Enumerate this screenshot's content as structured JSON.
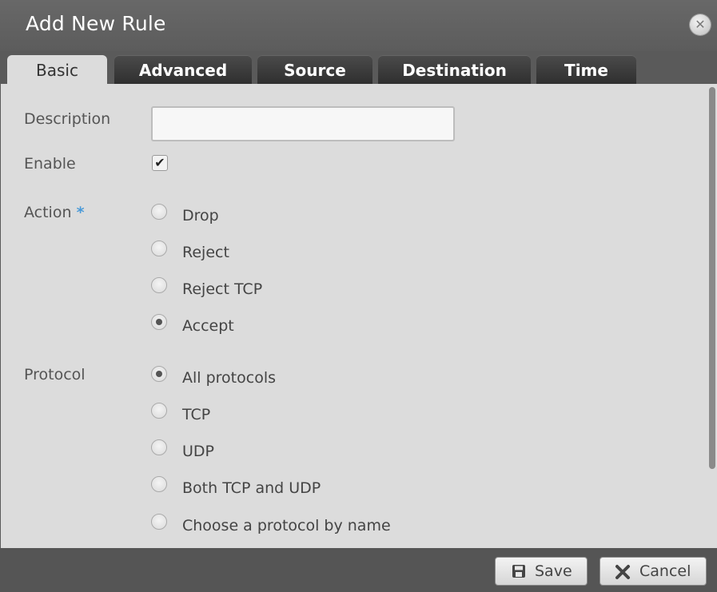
{
  "dialog": {
    "title": "Add New Rule",
    "close_icon": "close-icon"
  },
  "tabs": [
    {
      "label": "Basic",
      "active": true
    },
    {
      "label": "Advanced"
    },
    {
      "label": "Source"
    },
    {
      "label": "Destination"
    },
    {
      "label": "Time"
    }
  ],
  "basic": {
    "description": {
      "label": "Description",
      "value": "",
      "placeholder": ""
    },
    "enable": {
      "label": "Enable",
      "checked": true
    },
    "action": {
      "label": "Action",
      "required_mark": "*",
      "options": [
        "Drop",
        "Reject",
        "Reject TCP",
        "Accept"
      ],
      "selected": "Accept"
    },
    "protocol": {
      "label": "Protocol",
      "options": [
        "All protocols",
        "TCP",
        "UDP",
        "Both TCP and UDP",
        "Choose a protocol by name"
      ],
      "selected": "All protocols"
    }
  },
  "footer": {
    "save_label": "Save",
    "save_icon": "save-icon",
    "cancel_label": "Cancel",
    "cancel_icon": "cancel-icon"
  },
  "colors": {
    "tab_active": "#dcdcdc",
    "tab_inactive": "#3b3b3b",
    "required_accent": "#4a9ad8",
    "panel": "#dcdcdc",
    "titlebar": "#626262"
  }
}
